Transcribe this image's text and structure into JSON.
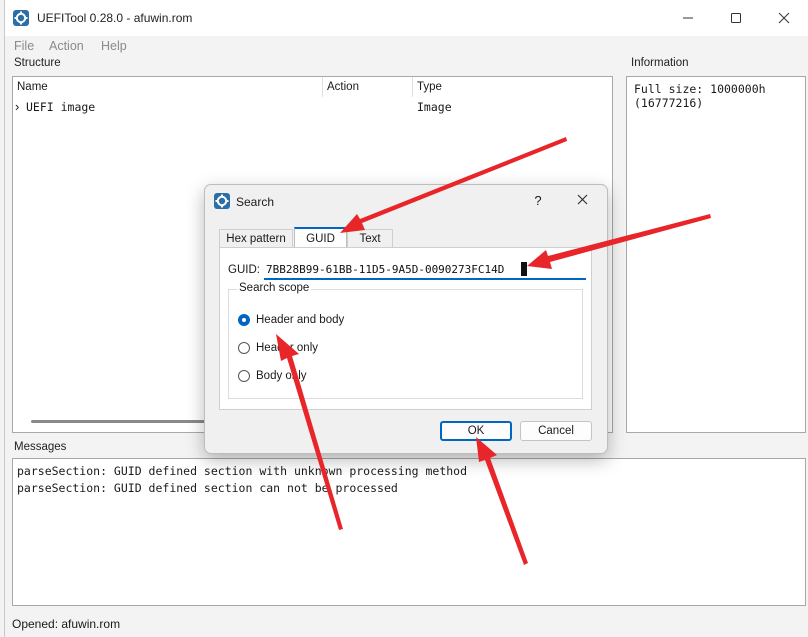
{
  "window": {
    "title": "UEFITool 0.28.0 - afuwin.rom"
  },
  "menu": [
    "File",
    "Action",
    "Help"
  ],
  "structure": {
    "label": "Structure",
    "columns": [
      "Name",
      "Action",
      "Type"
    ],
    "rows": [
      {
        "name": "UEFI image",
        "action": "",
        "type": "Image",
        "expand_glyph": "›"
      }
    ]
  },
  "information": {
    "label": "Information",
    "lines": [
      "Full size: 1000000h",
      "(16777216)"
    ]
  },
  "messages": {
    "label": "Messages",
    "lines": [
      "parseSection: GUID defined section with unknown processing method",
      "parseSection: GUID defined section can not be processed"
    ]
  },
  "status": "Opened: afuwin.rom",
  "dialog": {
    "title": "Search",
    "help": "?",
    "tabs": [
      "Hex pattern",
      "GUID",
      "Text"
    ],
    "active_tab": "GUID",
    "guid_label": "GUID:",
    "guid_value": "7BB28B99-61BB-11D5-9A5D-0090273FC14D",
    "scope_title": "Search scope",
    "scope_options": [
      "Header and body",
      "Header only",
      "Body only"
    ],
    "selected_scope": "Header and body",
    "ok": "OK",
    "cancel": "Cancel"
  },
  "colors": {
    "accent": "#0067c0",
    "annotation_arrows": "#e8262a"
  },
  "icons": {
    "app": "gear-icon",
    "minimize": "minimize-icon",
    "maximize": "maximize-icon",
    "close": "close-icon"
  }
}
